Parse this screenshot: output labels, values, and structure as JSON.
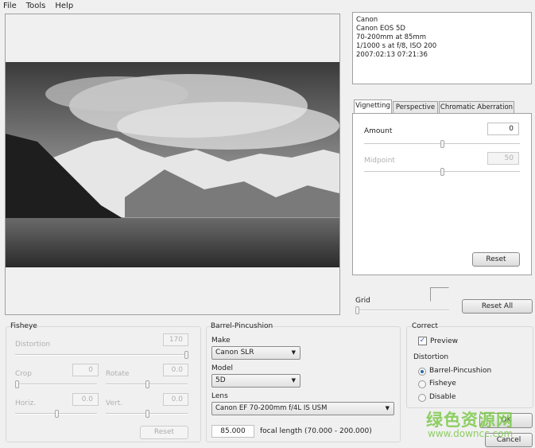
{
  "menu": [
    "File",
    "Tools",
    "Help"
  ],
  "exif": [
    "Canon",
    "Canon EOS 5D",
    "70-200mm at 85mm",
    "1/1000 s at f/8, ISO 200",
    "2007:02:13 07:21:36"
  ],
  "tabs": [
    "Vignetting",
    "Perspective",
    "Chromatic Aberration"
  ],
  "vignetting": {
    "amount_label": "Amount",
    "amount": "0",
    "amount_level": 0.5,
    "midpoint_label": "Midpoint",
    "midpoint": "50",
    "midpoint_level": 0.5,
    "reset": "Reset"
  },
  "grid": {
    "label": "Grid",
    "level": 0
  },
  "reset_all": "Reset All",
  "fisheye": {
    "title": "Fisheye",
    "distortion_label": "Distortion",
    "distortion": "170",
    "crop_label": "Crop",
    "crop": "0",
    "rotate_label": "Rotate",
    "rotate": "0.0",
    "horiz_label": "Horiz.",
    "horiz": "0.0",
    "vert_label": "Vert.",
    "vert": "0.0",
    "reset": "Reset"
  },
  "barrel": {
    "title": "Barrel-Pincushion",
    "make_label": "Make",
    "make": "Canon SLR",
    "model_label": "Model",
    "model": "5D",
    "lens_label": "Lens",
    "lens": "Canon EF 70-200mm f/4L IS USM",
    "focal": "85.000",
    "focal_label": "focal length (70.000 - 200.000)"
  },
  "correct": {
    "title": "Correct",
    "preview": "Preview",
    "preview_checked": true,
    "distortion_title": "Distortion",
    "options": [
      "Barrel-Pincushion",
      "Fisheye",
      "Disable"
    ],
    "selected": "Barrel-Pincushion"
  },
  "ok": "OK",
  "cancel": "Cancel",
  "watermark": {
    "cn": "绿色资源网",
    "url": "www.downcc.com"
  }
}
